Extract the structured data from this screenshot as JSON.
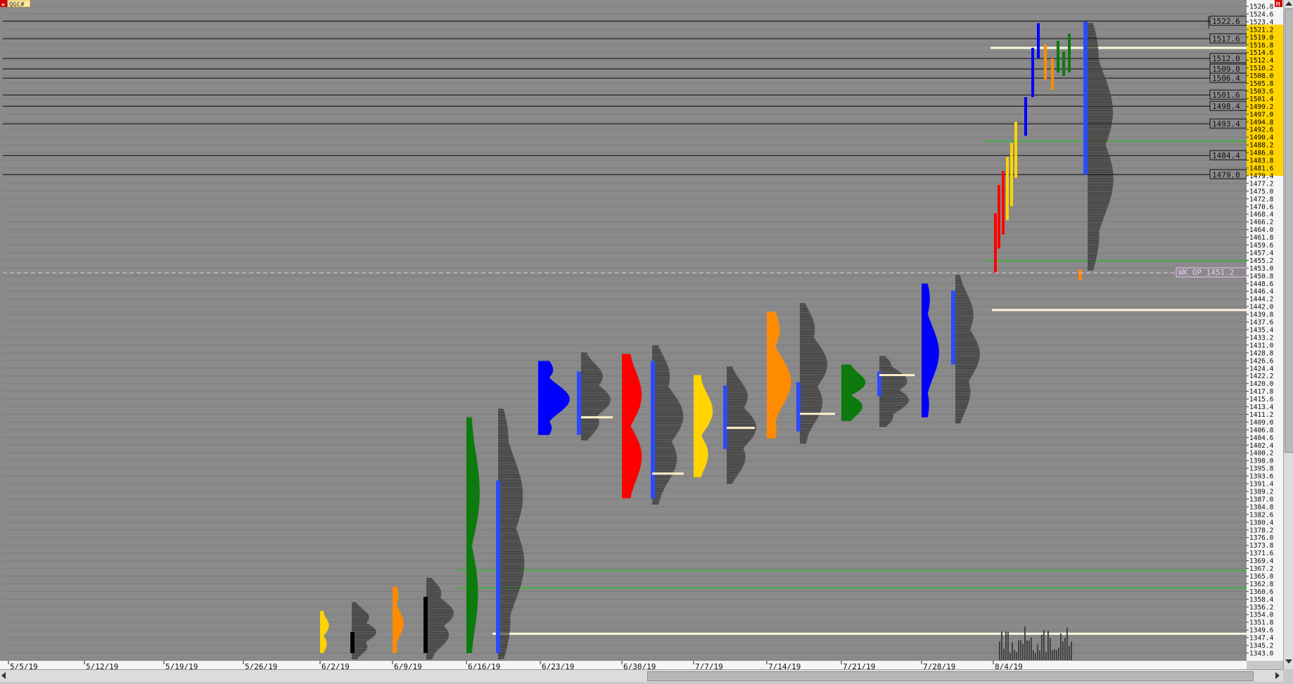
{
  "window": {
    "symbol": "QGC#",
    "corner_tag": "M"
  },
  "colors": {
    "background": "#8a8a8a",
    "grid": "#7c7c7c",
    "hline": "#0a0a0a",
    "cream": "#fff7dc",
    "green_line": "#2eb82e",
    "week_open": "#e9c6f2",
    "axis_bg": "#f5f5f5",
    "yellow_label": "#ffd400",
    "profile_gray": "#3a3a3a",
    "tpo_colors": [
      "#ffd400",
      "#ff8c00",
      "#0d7a0d",
      "#0000ff",
      "#ff0000"
    ],
    "range_bar": "#2b4bff",
    "poc": "#fff0c8"
  },
  "price_axis": {
    "labels": [
      "1526.8",
      "1524.6",
      "1523.4",
      "1521.2",
      "1519.0",
      "1516.8",
      "1514.6",
      "1512.4",
      "1510.2",
      "1508.0",
      "1505.8",
      "1503.6",
      "1501.4",
      "1499.2",
      "1497.0",
      "1494.8",
      "1492.6",
      "1490.4",
      "1488.2",
      "1486.0",
      "1483.8",
      "1481.6",
      "1479.4",
      "1477.2",
      "1475.0",
      "1472.8",
      "1470.6",
      "1468.4",
      "1466.2",
      "1464.0",
      "1461.8",
      "1459.6",
      "1457.4",
      "1455.2",
      "1453.0",
      "1450.8",
      "1448.6",
      "1446.4",
      "1444.2",
      "1442.0",
      "1439.8",
      "1437.6",
      "1435.4",
      "1433.2",
      "1431.0",
      "1428.8",
      "1426.6",
      "1424.4",
      "1422.2",
      "1420.0",
      "1417.8",
      "1415.6",
      "1413.4",
      "1411.2",
      "1409.0",
      "1406.8",
      "1404.6",
      "1402.4",
      "1400.2",
      "1398.0",
      "1395.8",
      "1393.6",
      "1391.4",
      "1389.2",
      "1387.0",
      "1384.8",
      "1382.6",
      "1380.4",
      "1378.2",
      "1376.0",
      "1373.8",
      "1371.6",
      "1369.4",
      "1367.2",
      "1365.0",
      "1362.8",
      "1360.6",
      "1358.4",
      "1356.2",
      "1354.0",
      "1351.8",
      "1349.6",
      "1347.4",
      "1345.2",
      "1343.0"
    ],
    "highlight_labels": [
      "1521.2",
      "1519.0",
      "1516.8",
      "1514.6",
      "1512.4",
      "1510.2",
      "1508.0",
      "1505.8",
      "1503.6",
      "1501.4",
      "1499.2",
      "1497.0",
      "1494.8",
      "1492.6",
      "1490.4",
      "1488.2",
      "1486.0",
      "1483.8",
      "1481.6",
      "1479.4"
    ]
  },
  "reference_levels": [
    "1522.6",
    "1517.6",
    "1512.0",
    "1509.0",
    "1506.4",
    "1501.6",
    "1498.4",
    "1493.4",
    "1484.4",
    "1479.0"
  ],
  "week_open_label": "WK OP 1451.2",
  "date_axis": [
    "5/5/19",
    "5/12/19",
    "5/19/19",
    "5/26/19",
    "6/2/19",
    "6/9/19",
    "6/16/19",
    "6/23/19",
    "6/30/19",
    "7/7/19",
    "7/14/19",
    "7/21/19",
    "7/28/19",
    "8/4/19"
  ]
}
